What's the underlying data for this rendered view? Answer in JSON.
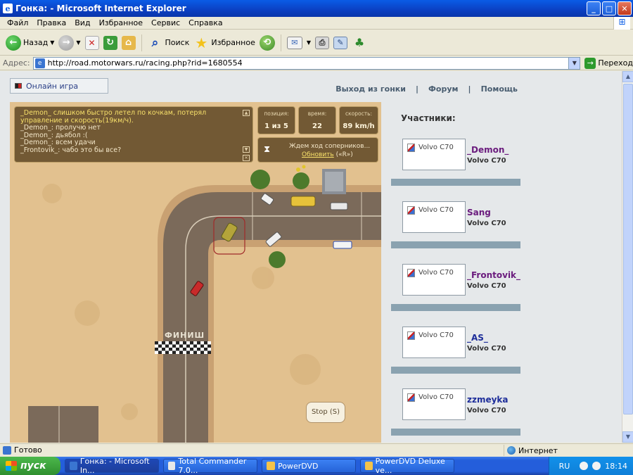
{
  "window": {
    "title": "Гонка: - Microsoft Internet Explorer",
    "buttons": [
      "_",
      "□",
      "✕"
    ]
  },
  "menu": [
    "Файл",
    "Правка",
    "Вид",
    "Избранное",
    "Сервис",
    "Справка"
  ],
  "toolbar": {
    "back_label": "Назад",
    "search_label": "Поиск",
    "favorites_label": "Избранное"
  },
  "address": {
    "label": "Адрес:",
    "url": "http://road.motorwars.ru/racing.php?rid=1680554",
    "go_label": "Переход"
  },
  "page": {
    "online_game_label": "Онлайн игра",
    "nav": [
      "Выход из гонки",
      "|",
      "Форум",
      "|",
      "Помощь"
    ]
  },
  "chat": {
    "lines": [
      {
        "text": "_Demon_ слишком быстро летел по кочкам, потерял управление и скорость(19км/ч).",
        "highlight": true
      },
      {
        "text": "_Demon_: пролучю нет",
        "highlight": false
      },
      {
        "text": "_Demon_: дьябол :(",
        "highlight": false
      },
      {
        "text": "_Demon_: всем удачи",
        "highlight": false
      },
      {
        "text": "_Frontovik_: чабо это бы все?",
        "highlight": false
      }
    ]
  },
  "stats": {
    "position_label": "позиция:",
    "position_value": "1 из 5",
    "time_label": "время:",
    "time_value": "22",
    "speed_label": "скорость:",
    "speed_value": "89 km/h"
  },
  "wait": {
    "text": "Ждем ход соперников...",
    "refresh_link": "Обновить",
    "hotkey": "(«R»)"
  },
  "finish_label": "ФИНИШ",
  "stop_button": "Stop (S)",
  "participants": {
    "heading": "Участники:",
    "list": [
      {
        "name": "_Demon_",
        "car": "Volvo C70",
        "image_alt": "Volvo C70",
        "color": "#6a1b7d"
      },
      {
        "name": "Sang",
        "car": "Volvo C70",
        "image_alt": "Volvo C70",
        "color": "#6a1b7d"
      },
      {
        "name": "_Frontovik_",
        "car": "Volvo C70",
        "image_alt": "Volvo C70",
        "color": "#6a1b7d"
      },
      {
        "name": "_AS_",
        "car": "Volvo C70",
        "image_alt": "Volvo C70",
        "color": "#1d2d9a"
      },
      {
        "name": "zzmeyka",
        "car": "Volvo C70",
        "image_alt": "Volvo C70",
        "color": "#1d2d9a"
      }
    ]
  },
  "status": {
    "text": "Готово",
    "zone": "Интернет"
  },
  "taskbar": {
    "start_label": "пуск",
    "tasks": [
      "Гонка: - Microsoft In...",
      "Total Commander 7.0...",
      "PowerDVD",
      "PowerDVD Deluxe ve..."
    ],
    "lang": "RU",
    "clock": "18:14"
  }
}
